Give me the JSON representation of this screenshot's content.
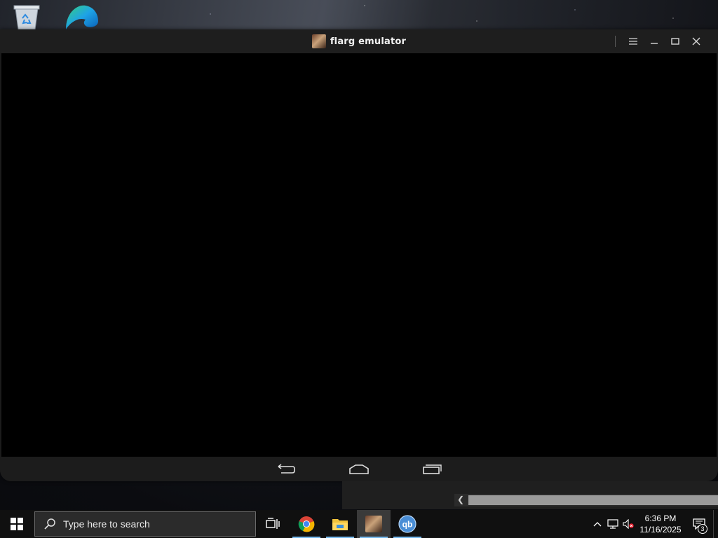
{
  "window": {
    "title": "flarg emulator"
  },
  "search": {
    "placeholder": "Type here to search"
  },
  "clock": {
    "time": "6:36 PM",
    "date": "11/16/2025"
  },
  "notifications": {
    "count": "3"
  },
  "colors": {
    "accent": "#76b9ed",
    "titlebar": "#1e1e1e",
    "screen": "#000000",
    "taskbar": "#101010"
  },
  "icons": {
    "desktop": [
      "recycle-bin-icon",
      "edge-icon"
    ],
    "taskbar": [
      "start-icon",
      "search-icon",
      "task-view-icon",
      "chrome-icon",
      "file-explorer-icon",
      "flarg-emulator-icon",
      "qbittorrent-icon"
    ],
    "tray": [
      "chevron-up-icon",
      "network-icon",
      "volume-muted-icon",
      "action-center-icon"
    ]
  }
}
